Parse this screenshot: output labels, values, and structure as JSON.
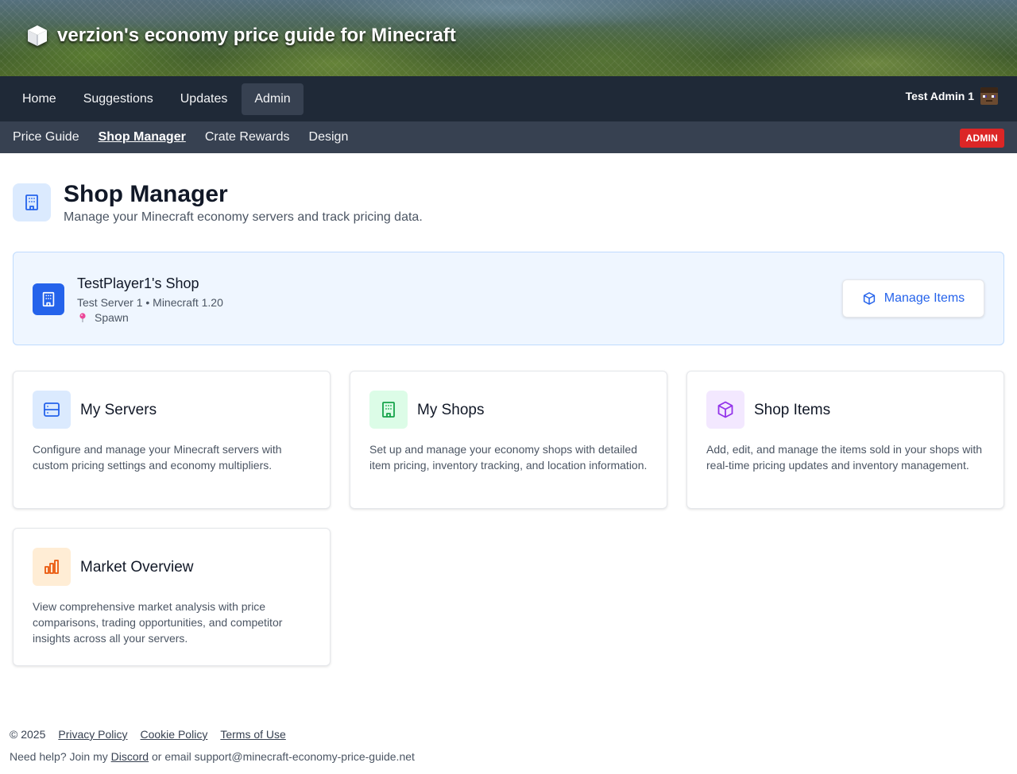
{
  "banner": {
    "title": "verzion's economy price guide for Minecraft",
    "icon": "cube-icon"
  },
  "main_nav": {
    "items": [
      {
        "label": "Home",
        "active": false
      },
      {
        "label": "Suggestions",
        "active": false
      },
      {
        "label": "Updates",
        "active": false
      },
      {
        "label": "Admin",
        "active": true
      }
    ],
    "user_name": "Test Admin 1"
  },
  "sub_nav": {
    "items": [
      {
        "label": "Price Guide",
        "active": false
      },
      {
        "label": "Shop Manager",
        "active": true
      },
      {
        "label": "Crate Rewards",
        "active": false
      },
      {
        "label": "Design",
        "active": false
      }
    ],
    "badge": "ADMIN"
  },
  "page": {
    "title": "Shop Manager",
    "subtitle": "Manage your Minecraft economy servers and track pricing data."
  },
  "shop_panel": {
    "name": "TestPlayer1's Shop",
    "meta": "Test Server 1 • Minecraft 1.20",
    "location": "Spawn",
    "button_label": "Manage Items"
  },
  "cards": [
    {
      "title": "My Servers",
      "description": "Configure and manage your Minecraft servers with custom pricing settings and economy multipliers.",
      "icon": "server-icon",
      "accent": "#2563eb"
    },
    {
      "title": "My Shops",
      "description": "Set up and manage your economy shops with detailed item pricing, inventory tracking, and location information.",
      "icon": "building-icon",
      "accent": "#16a34a"
    },
    {
      "title": "Shop Items",
      "description": "Add, edit, and manage the items sold in your shops with real-time pricing updates and inventory management.",
      "icon": "box-icon",
      "accent": "#9333ea"
    },
    {
      "title": "Market Overview",
      "description": "View comprehensive market analysis with price comparisons, trading opportunities, and competitor insights across all your servers.",
      "icon": "bar-chart-icon",
      "accent": "#ea580c"
    }
  ],
  "footer": {
    "copyright": "© 2025",
    "links": [
      "Privacy Policy",
      "Cookie Policy",
      "Terms of Use"
    ],
    "help_prefix": "Need help? Join my",
    "discord": "Discord",
    "help_suffix": "or email support@minecraft-economy-price-guide.net"
  },
  "colors": {
    "nav_bg": "#1f2937",
    "subnav_bg": "#374151",
    "primary": "#2563eb",
    "badge_red": "#dc2626",
    "shop_panel_bg": "#eff6ff"
  }
}
